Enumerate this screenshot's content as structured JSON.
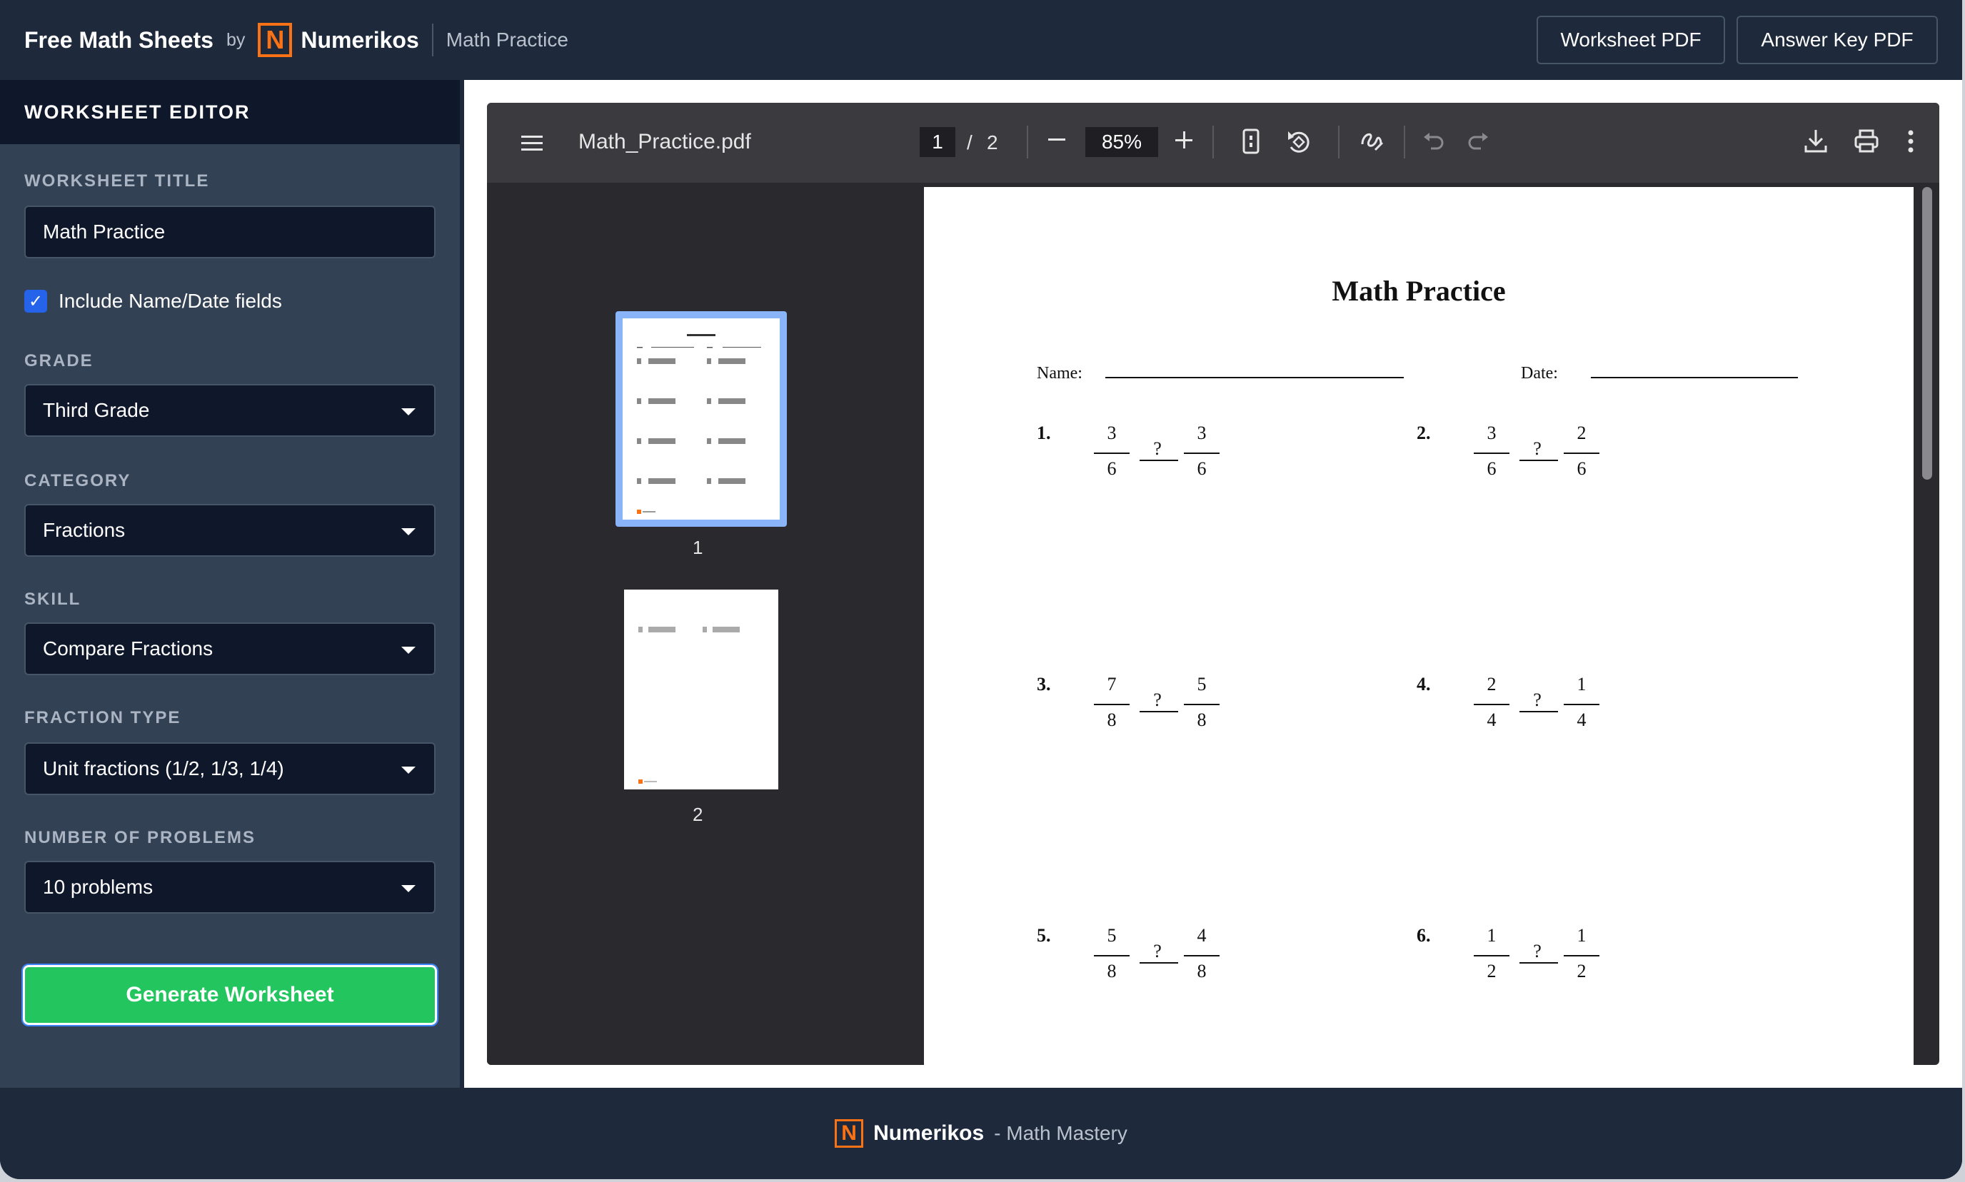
{
  "header": {
    "title": "Free Math Sheets",
    "by": "by",
    "logo_letter": "N",
    "brand": "Numerikos",
    "subtitle": "Math Practice",
    "worksheet_pdf": "Worksheet PDF",
    "answer_key_pdf": "Answer Key PDF"
  },
  "sidebar": {
    "heading": "WORKSHEET EDITOR",
    "title_label": "WORKSHEET TITLE",
    "title_value": "Math Practice",
    "include_name_date": "Include Name/Date fields",
    "include_checked": true,
    "grade_label": "GRADE",
    "grade_value": "Third Grade",
    "category_label": "CATEGORY",
    "category_value": "Fractions",
    "skill_label": "SKILL",
    "skill_value": "Compare Fractions",
    "fraction_type_label": "FRACTION TYPE",
    "fraction_type_value": "Unit fractions (1/2, 1/3, 1/4)",
    "num_problems_label": "NUMBER OF PROBLEMS",
    "num_problems_value": "10 problems",
    "generate": "Generate Worksheet"
  },
  "viewer": {
    "filename": "Math_Practice.pdf",
    "page_current": "1",
    "page_sep": "/",
    "page_total": "2",
    "zoom": "85%",
    "thumb_labels": [
      "1",
      "2"
    ]
  },
  "worksheet": {
    "title": "Math Practice",
    "name_label": "Name:",
    "date_label": "Date:",
    "problems": [
      {
        "num": "1.",
        "a_n": "3",
        "a_d": "6",
        "op": "?",
        "b_n": "3",
        "b_d": "6"
      },
      {
        "num": "2.",
        "a_n": "3",
        "a_d": "6",
        "op": "?",
        "b_n": "2",
        "b_d": "6"
      },
      {
        "num": "3.",
        "a_n": "7",
        "a_d": "8",
        "op": "?",
        "b_n": "5",
        "b_d": "8"
      },
      {
        "num": "4.",
        "a_n": "2",
        "a_d": "4",
        "op": "?",
        "b_n": "1",
        "b_d": "4"
      },
      {
        "num": "5.",
        "a_n": "5",
        "a_d": "8",
        "op": "?",
        "b_n": "4",
        "b_d": "8"
      },
      {
        "num": "6.",
        "a_n": "1",
        "a_d": "2",
        "op": "?",
        "b_n": "1",
        "b_d": "2"
      }
    ]
  },
  "footer": {
    "logo_letter": "N",
    "brand": "Numerikos",
    "tagline": "- Math Mastery"
  }
}
